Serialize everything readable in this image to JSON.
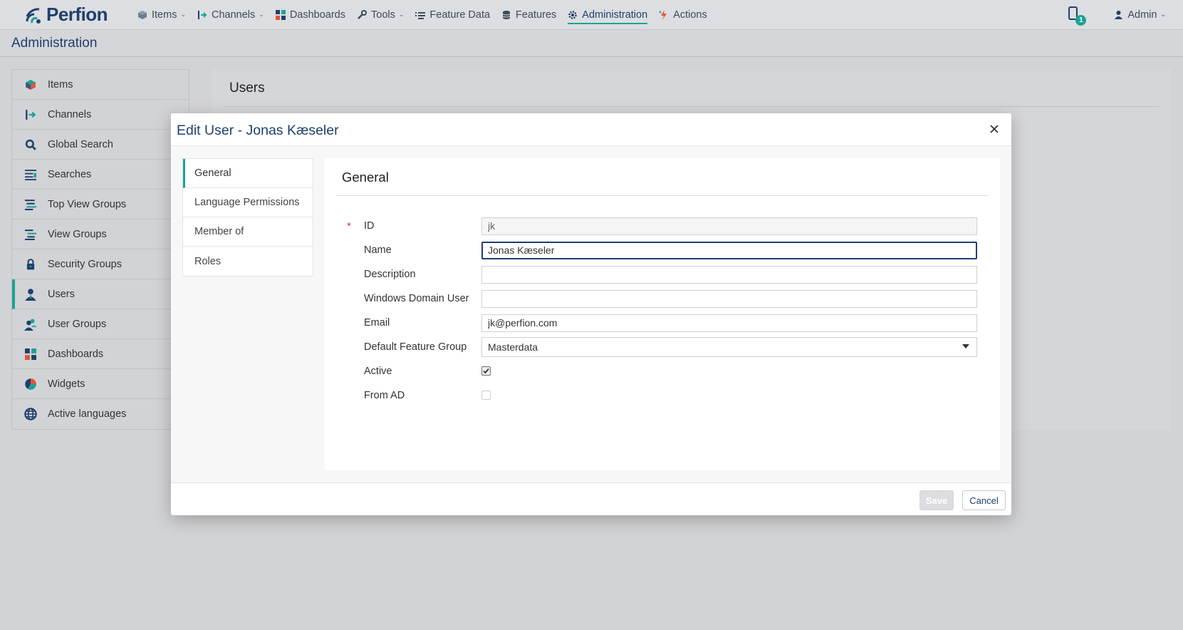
{
  "app": {
    "brand": "Perfion"
  },
  "navbar": {
    "items": [
      {
        "label": "Items",
        "icon": "cube-icon",
        "dropdown": true
      },
      {
        "label": "Channels",
        "icon": "channel-icon",
        "dropdown": true
      },
      {
        "label": "Dashboards",
        "icon": "dashboard-icon",
        "dropdown": false
      },
      {
        "label": "Tools",
        "icon": "wrench-icon",
        "dropdown": true
      },
      {
        "label": "Feature Data",
        "icon": "list-icon",
        "dropdown": false
      },
      {
        "label": "Features",
        "icon": "database-icon",
        "dropdown": false
      },
      {
        "label": "Administration",
        "icon": "gear-icon",
        "dropdown": false,
        "active": true
      },
      {
        "label": "Actions",
        "icon": "lightning-icon",
        "dropdown": false
      }
    ],
    "notifications_count": "1",
    "user_label": "Admin"
  },
  "page": {
    "title": "Administration"
  },
  "sidebar": {
    "items": [
      {
        "label": "Items",
        "icon": "cube-icon"
      },
      {
        "label": "Channels",
        "icon": "channel-icon"
      },
      {
        "label": "Global Search",
        "icon": "search-icon"
      },
      {
        "label": "Searches",
        "icon": "searches-icon"
      },
      {
        "label": "Top View Groups",
        "icon": "top-view-groups-icon"
      },
      {
        "label": "View Groups",
        "icon": "view-groups-icon"
      },
      {
        "label": "Security Groups",
        "icon": "lock-icon"
      },
      {
        "label": "Users",
        "icon": "user-icon",
        "active": true
      },
      {
        "label": "User Groups",
        "icon": "user-groups-icon"
      },
      {
        "label": "Dashboards",
        "icon": "dashboard-icon"
      },
      {
        "label": "Widgets",
        "icon": "pie-chart-icon"
      },
      {
        "label": "Active languages",
        "icon": "globe-icon"
      }
    ]
  },
  "users_panel": {
    "title": "Users"
  },
  "modal": {
    "title": "Edit User - Jonas Kæseler",
    "tabs": [
      {
        "label": "General",
        "active": true
      },
      {
        "label": "Language Permissions"
      },
      {
        "label": "Member of"
      },
      {
        "label": "Roles"
      }
    ],
    "section_title": "General",
    "fields": {
      "id": {
        "label": "ID",
        "value": "jk",
        "required": "*"
      },
      "name": {
        "label": "Name",
        "value": "Jonas Kæseler"
      },
      "description": {
        "label": "Description",
        "value": ""
      },
      "windows_domain_user": {
        "label": "Windows Domain User",
        "value": ""
      },
      "email": {
        "label": "Email",
        "value": "jk@perfion.com"
      },
      "default_feature_group": {
        "label": "Default Feature Group",
        "value": "Masterdata"
      },
      "active": {
        "label": "Active",
        "checked": true
      },
      "from_ad": {
        "label": "From AD",
        "checked": false
      }
    },
    "buttons": {
      "save": "Save",
      "cancel": "Cancel"
    }
  },
  "colors": {
    "brand": "#1f3f6e",
    "accent": "#1aa394",
    "required": "#d9334a"
  }
}
